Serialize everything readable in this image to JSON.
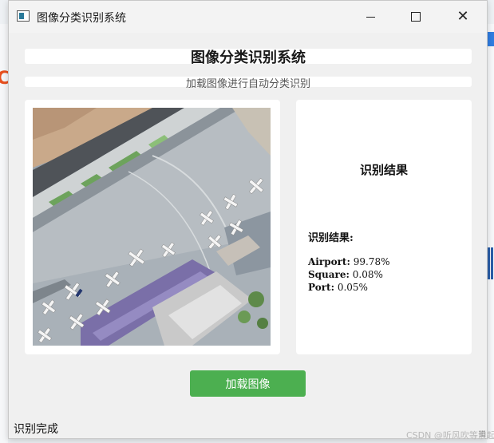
{
  "window": {
    "title": "图像分类识别系统"
  },
  "header": {
    "title": "图像分类识别系统",
    "subtitle": "加载图像进行自动分类识别"
  },
  "image_panel": {
    "image_alt": "aerial-airport-image"
  },
  "result_panel": {
    "heading": "识别结果",
    "label": "识别结果:",
    "results": [
      {
        "class": "Airport:",
        "prob": "99.78%"
      },
      {
        "class": "Square:",
        "prob": "0.08%"
      },
      {
        "class": "Port:",
        "prob": "0.05%"
      }
    ]
  },
  "actions": {
    "load_label": "加载图像",
    "load_color": "#4caf50"
  },
  "status": {
    "text": "识别完成"
  },
  "watermark": {
    "text": "CSDN @听风吹等浪起"
  }
}
